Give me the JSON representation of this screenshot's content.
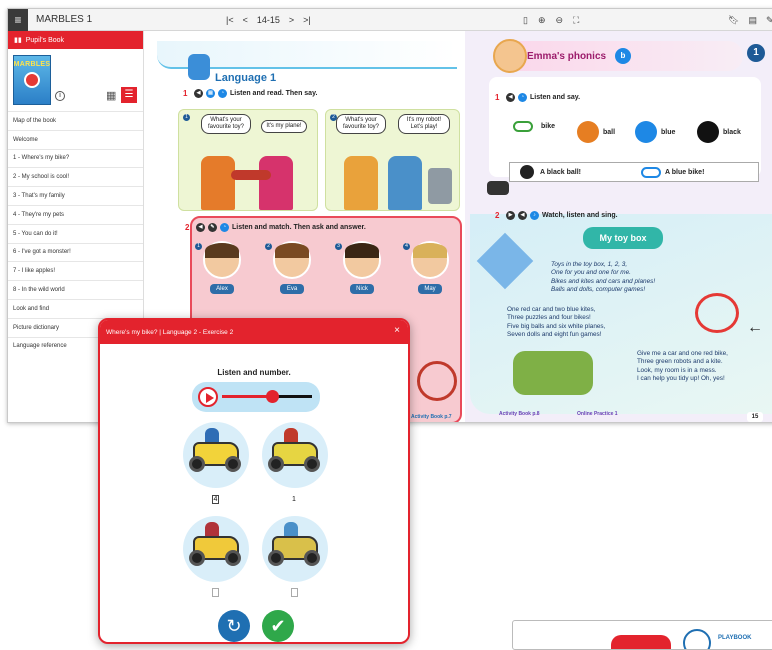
{
  "app": {
    "title": "MARBLES 1",
    "page_label": "14-15",
    "nav": {
      "first": "|<",
      "prev": "<",
      "next": ">",
      "last": ">|"
    }
  },
  "sidebar": {
    "header": "Pupil's Book",
    "cover_title": "MARBLES",
    "items": [
      "Map of the book",
      "Welcome",
      "1 - Where's my bike?",
      "2 - My school is cool!",
      "3 - That's my family",
      "4 - They're my pets",
      "5 - You can do it!",
      "6 - I've got a monster!",
      "7 - I like apples!",
      "8 - In the wild world",
      "Look and find",
      "Picture dictionary",
      "Language reference"
    ]
  },
  "left_page": {
    "title": "Language 1",
    "ex1": {
      "num": "1",
      "instruction": "Listen and read. Then say."
    },
    "scene1": {
      "num": "1",
      "bubble_a": "What's your favourite toy?",
      "bubble_b": "It's my plane!"
    },
    "scene2": {
      "num": "2",
      "bubble_a": "What's your favourite toy?",
      "bubble_b": "It's my robot! Let's play!"
    },
    "ex2": {
      "num": "2",
      "instruction": "Listen and match. Then ask and answer."
    },
    "kids": [
      {
        "num": "1",
        "name": "Alex"
      },
      {
        "num": "2",
        "name": "Eva"
      },
      {
        "num": "3",
        "name": "Nick"
      },
      {
        "num": "4",
        "name": "May"
      }
    ],
    "footer": "Activity Book p.7"
  },
  "right_page": {
    "title": "Emma's phonics",
    "badge": "b",
    "unit": "1",
    "ex1": {
      "num": "1",
      "instruction": "Listen and say."
    },
    "words": [
      "bike",
      "ball",
      "blue",
      "black"
    ],
    "sentences": [
      "A black ball!",
      "A blue bike!"
    ],
    "ex2": {
      "num": "2",
      "instruction": "Watch, listen and sing."
    },
    "song_title": "My toy box",
    "verse1": [
      "Toys in the toy box, 1, 2, 3,",
      "One for you and one for me.",
      "Bikes and kites and cars and planes!",
      "Balls and dolls, computer games!"
    ],
    "verse2": [
      "One red car and two blue kites,",
      "Three puzzles and four bikes!",
      "Five big balls and six white planes,",
      "Seven dolls and eight fun games!"
    ],
    "verse3": [
      "Give me a car and one red bike,",
      "Three green robots and a kite.",
      "Look, my room is in a mess.",
      "I can help you tidy up! Oh, yes!"
    ],
    "footer_ab": "Activity Book p.8",
    "footer_op": "Online Practice 1",
    "page_num": "15"
  },
  "modal": {
    "title": "Where's my bike? | Language 2 - Exercise 2",
    "close": "×",
    "instruction": "Listen and number.",
    "audio_progress": 0.55,
    "answers": [
      "4",
      "1",
      "",
      ""
    ]
  },
  "peek": {
    "text": "PLAYBOOK"
  },
  "colors": {
    "brand_red": "#e3232d",
    "accent_blue": "#1f6fb2",
    "success_green": "#2fa84a"
  }
}
